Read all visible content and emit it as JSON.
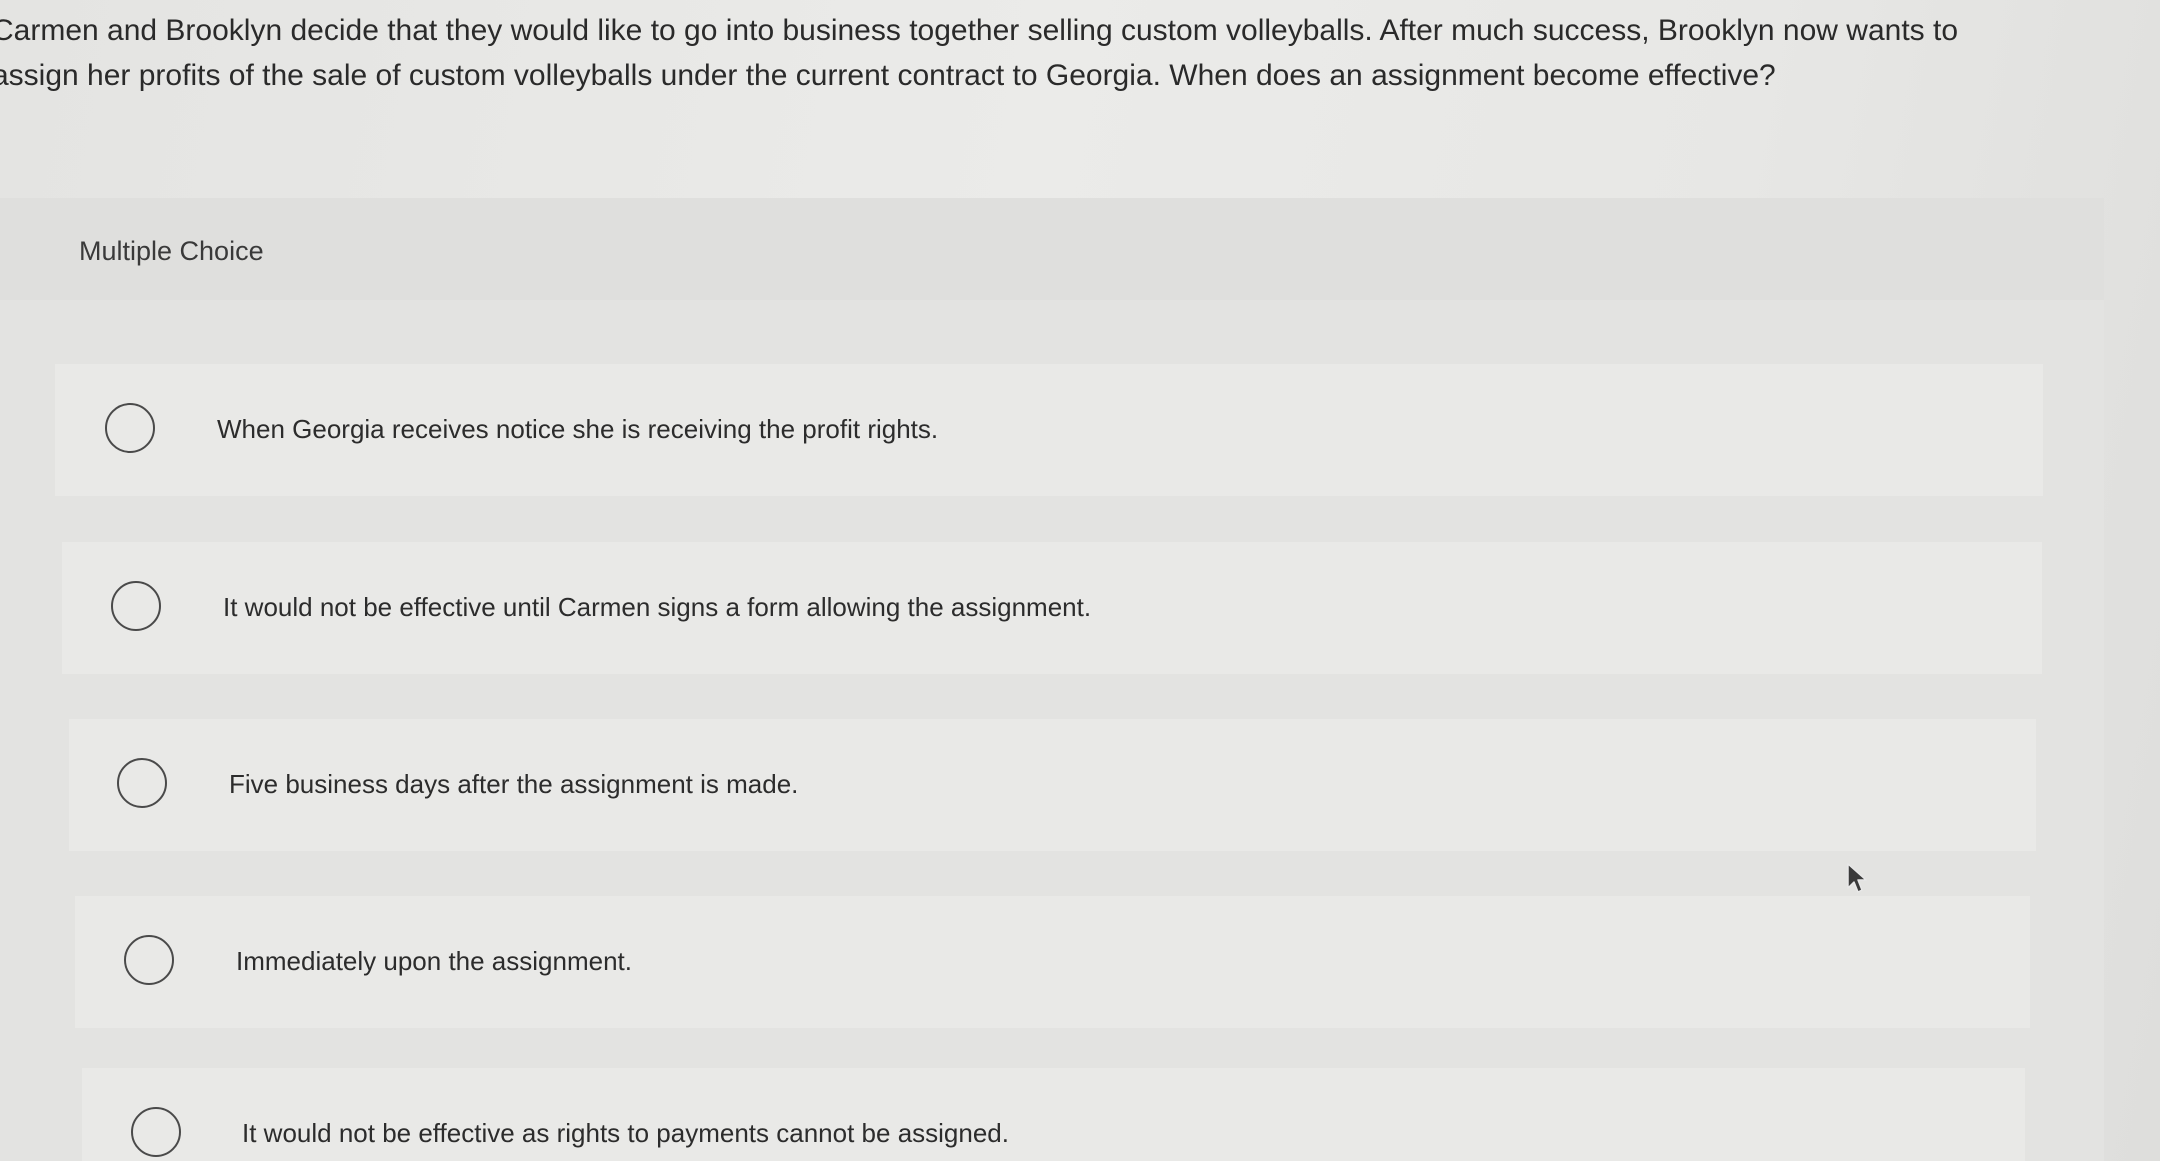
{
  "question": {
    "text": "Carmen and Brooklyn decide that they would like to go into business together selling custom volleyballs. After much success, Brooklyn now wants to\nassign her profits of the sale of custom volleyballs under the current contract to Georgia. When does an assignment become effective?"
  },
  "panel": {
    "title": "Multiple Choice"
  },
  "options": [
    {
      "label": "When Georgia receives notice she is receiving the profit rights.",
      "selected": false
    },
    {
      "label": "It would not be effective until Carmen signs a form allowing the assignment.",
      "selected": false
    },
    {
      "label": "Five business days after the assignment is made.",
      "selected": false
    },
    {
      "label": "Immediately upon the assignment.",
      "selected": false
    },
    {
      "label": "It would not be effective as rights to payments cannot be assigned.",
      "selected": false
    }
  ],
  "icons": {
    "radio": "radio-button-icon",
    "cursor": "mouse-pointer-icon"
  }
}
